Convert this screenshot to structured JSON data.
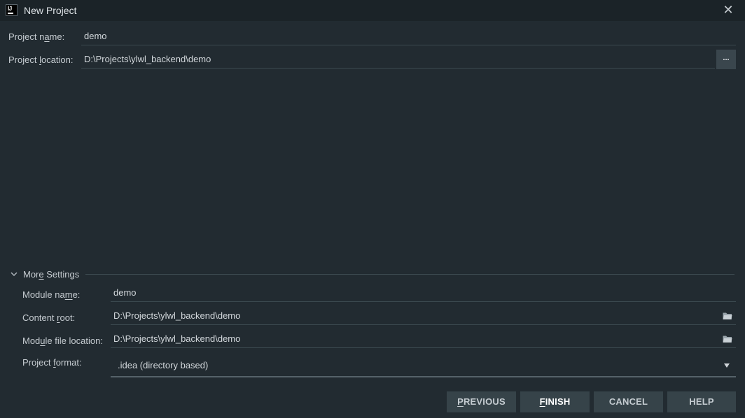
{
  "window": {
    "title": "New Project",
    "close_glyph": "✕"
  },
  "app_icon": {
    "text": "IJ"
  },
  "project": {
    "name_label_pre": "Project n",
    "name_label_u": "a",
    "name_label_post": "me:",
    "name_value": "demo",
    "location_label_pre": "Project ",
    "location_label_u": "l",
    "location_label_post": "ocation:",
    "location_value": "D:\\Projects\\ylwl_backend\\demo",
    "browse_label": "..."
  },
  "more_settings": {
    "title_pre": "Mor",
    "title_u": "e",
    "title_post": " Settings",
    "module_name_label_pre": "Module na",
    "module_name_label_u": "m",
    "module_name_label_post": "e:",
    "module_name_value": "demo",
    "content_root_label_pre": "Content ",
    "content_root_label_u": "r",
    "content_root_label_post": "oot:",
    "content_root_value": "D:\\Projects\\ylwl_backend\\demo",
    "module_file_label_pre": "Mod",
    "module_file_label_u": "u",
    "module_file_label_post": "le file location:",
    "module_file_value": "D:\\Projects\\ylwl_backend\\demo",
    "format_label_pre": "Project ",
    "format_label_u": "f",
    "format_label_post": "ormat:",
    "format_value": ".idea (directory based)"
  },
  "buttons": {
    "previous_u": "P",
    "previous_rest": "REVIOUS",
    "finish_u": "F",
    "finish_rest": "INISH",
    "cancel": "CANCEL",
    "help": "HELP"
  },
  "colors": {
    "background": "#222b31",
    "titlebar": "#1b2328",
    "button": "#364349",
    "underline": "#3c4a50"
  }
}
